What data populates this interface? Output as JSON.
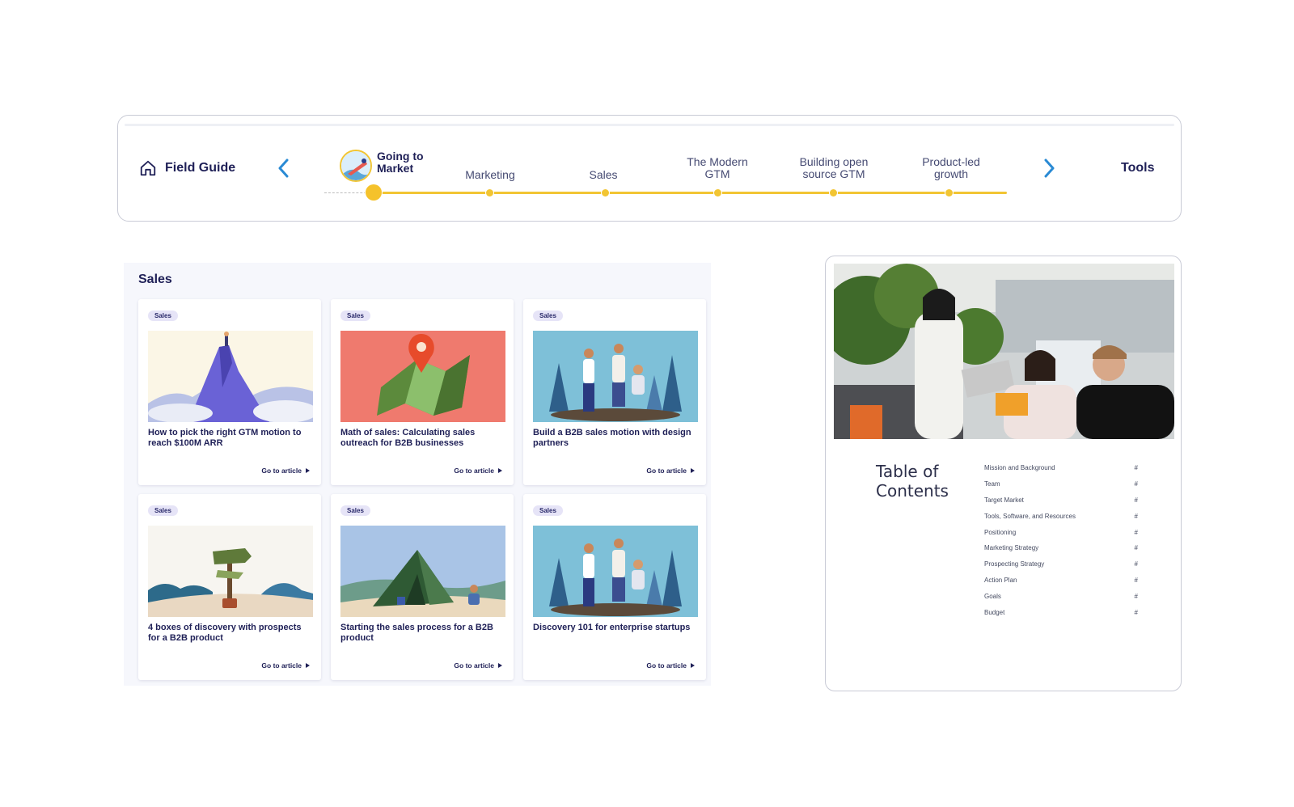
{
  "nav": {
    "home_label": "Field Guide",
    "tools_label": "Tools",
    "steps": [
      {
        "label": "Going to\nMarket",
        "active": true
      },
      {
        "label": "Marketing",
        "active": false
      },
      {
        "label": "Sales",
        "active": false
      },
      {
        "label": "The Modern\nGTM",
        "active": false
      },
      {
        "label": "Building open\nsource GTM",
        "active": false
      },
      {
        "label": "Product-led\ngrowth",
        "active": false
      }
    ],
    "icons": {
      "home": "home-icon",
      "prev": "chevron-left-icon",
      "next": "chevron-right-icon"
    },
    "colors": {
      "accent": "#f2c533",
      "arrow": "#2a8ad4",
      "text": "#1f2057"
    }
  },
  "sales": {
    "title": "Sales",
    "cards": [
      {
        "tag": "Sales",
        "title": "How to pick the right GTM motion to reach $100M ARR",
        "link": "Go to article",
        "illustration": "mountain-climber"
      },
      {
        "tag": "Sales",
        "title": "Math of sales: Calculating sales outreach for B2B businesses",
        "link": "Go to article",
        "illustration": "map-pin"
      },
      {
        "tag": "Sales",
        "title": "Build a B2B sales motion with design partners",
        "link": "Go to article",
        "illustration": "tree-planters"
      },
      {
        "tag": "Sales",
        "title": "4 boxes of discovery with prospects for a B2B product",
        "link": "Go to article",
        "illustration": "signpost"
      },
      {
        "tag": "Sales",
        "title": "Starting the sales process for a B2B product",
        "link": "Go to article",
        "illustration": "tent-camp"
      },
      {
        "tag": "Sales",
        "title": "Discovery 101 for enterprise startups",
        "link": "Go to article",
        "illustration": "tree-planters"
      }
    ]
  },
  "toc": {
    "heading": "Table of Contents",
    "items": [
      {
        "label": "Mission and Background",
        "page": "#"
      },
      {
        "label": "Team",
        "page": "#"
      },
      {
        "label": "Target Market",
        "page": "#"
      },
      {
        "label": "Tools, Software, and Resources",
        "page": "#"
      },
      {
        "label": "Positioning",
        "page": "#"
      },
      {
        "label": "Marketing Strategy",
        "page": "#"
      },
      {
        "label": "Prospecting Strategy",
        "page": "#"
      },
      {
        "label": "Action Plan",
        "page": "#"
      },
      {
        "label": "Goals",
        "page": "#"
      },
      {
        "label": "Budget",
        "page": "#"
      }
    ]
  }
}
